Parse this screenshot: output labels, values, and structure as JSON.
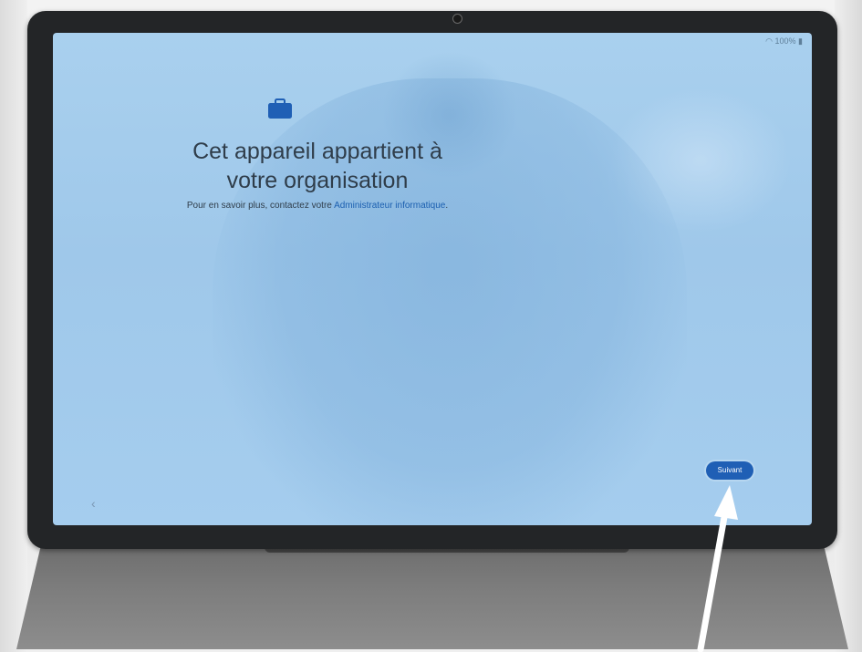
{
  "status_bar": {
    "battery": "100%"
  },
  "main": {
    "title_line1": "Cet appareil appartient à",
    "title_line2": "votre organisation",
    "subtitle_prefix": "Pour en savoir plus, contactez votre ",
    "subtitle_link": "Administrateur informatique",
    "subtitle_suffix": "."
  },
  "navigation": {
    "back_icon": "chevron-left-icon",
    "next_label": "Suivant"
  },
  "colors": {
    "screen_background": "#a5cdee",
    "accent": "#1f5fb5",
    "link": "#1b5fb0",
    "icon": "#1f5fb5"
  }
}
